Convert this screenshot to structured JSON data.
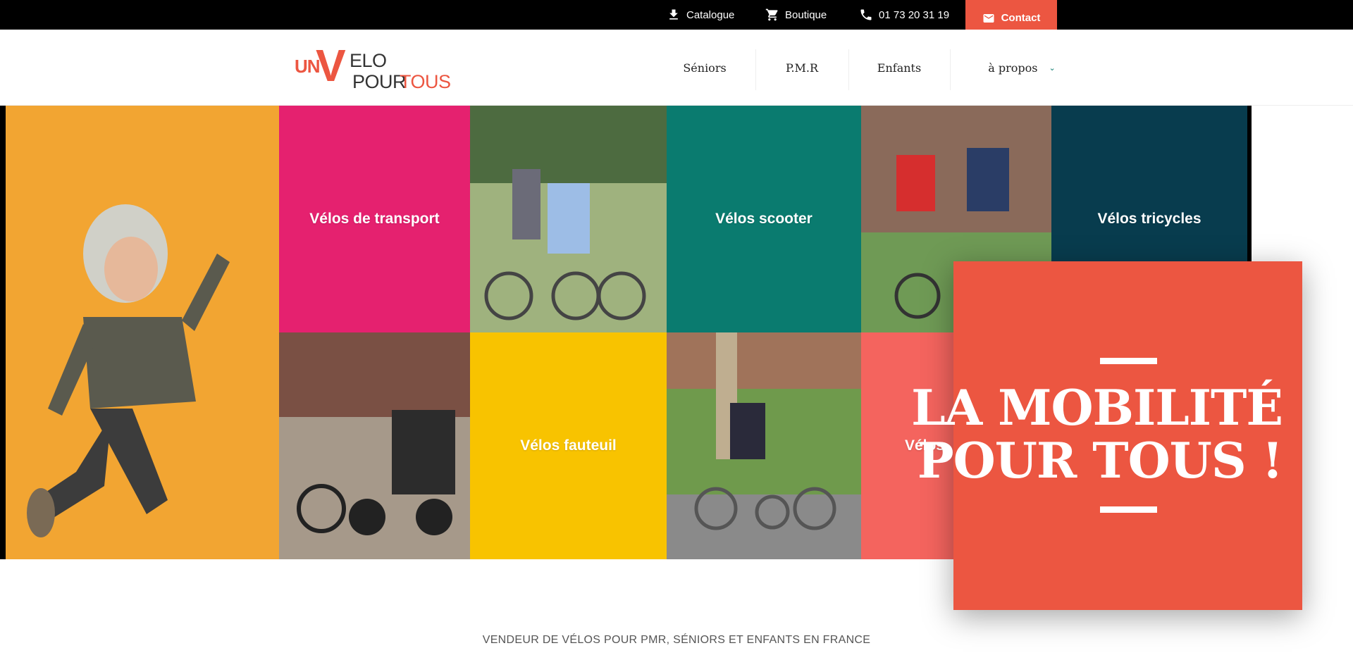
{
  "topbar": {
    "catalogue": "Catalogue",
    "boutique": "Boutique",
    "phone": "01 73 20 31 19",
    "contact": "Contact"
  },
  "logo": {
    "un": "UN",
    "v": "V",
    "elo": "ELO",
    "pour": "POUR",
    "tous": "TOUS"
  },
  "nav": {
    "items": [
      "Séniors",
      "P.M.R",
      "Enfants",
      "à propos"
    ]
  },
  "hero": {
    "tiles": [
      "Vélos de transport",
      "Vélos scooter",
      "Vélos tricycles",
      "Vélos fauteuil",
      "Vélos"
    ],
    "headline_line1": "LA MOBILITÉ",
    "headline_line2": "POUR TOUS !"
  },
  "tagline": "VENDEUR DE VÉLOS POUR PMR, SÉNIORS ET ENFANTS EN FRANCE",
  "colors": {
    "accent": "#ec5641",
    "orange": "#f2a532",
    "pink": "#e5216f",
    "teal": "#0a7b6f",
    "navy": "#083c4e",
    "yellow": "#f8c300",
    "coral": "#f4645e"
  }
}
